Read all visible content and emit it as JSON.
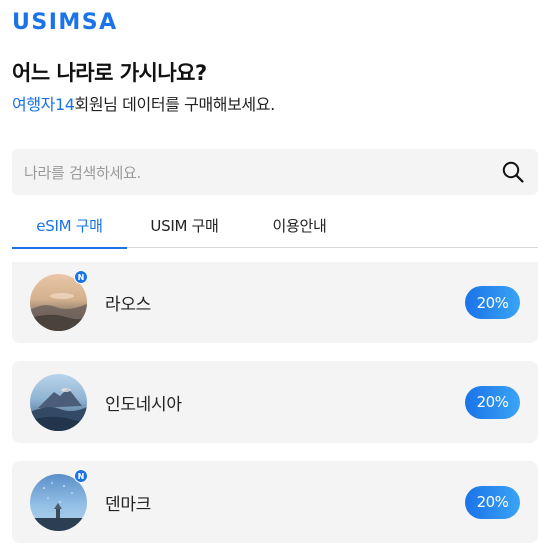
{
  "brand": {
    "logo_text": "USIMSA",
    "accent_color": "#1a73e8"
  },
  "header": {
    "headline": "어느 나라로 가시나요?",
    "subline_highlight": "여행자14",
    "subline_rest": "회원님 데이터를 구매해보세요."
  },
  "search": {
    "placeholder": "나라를 검색하세요.",
    "icon": "search-icon"
  },
  "tabs": [
    {
      "label": "eSIM 구매",
      "active": true
    },
    {
      "label": "USIM 구매",
      "active": false
    },
    {
      "label": "이용안내",
      "active": false
    }
  ],
  "countries": [
    {
      "name": "라오스",
      "discount": "20%",
      "new_badge": "N"
    },
    {
      "name": "인도네시아",
      "discount": "20%",
      "new_badge": ""
    },
    {
      "name": "덴마크",
      "discount": "20%",
      "new_badge": "N"
    }
  ]
}
